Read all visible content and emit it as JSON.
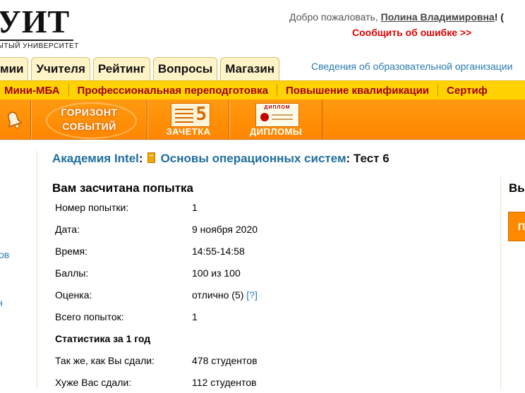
{
  "header": {
    "logo_big": "УИТ",
    "logo_small": "ЫТЫЙ УНИВЕРСИТЕТ",
    "welcome_prefix": "Добро пожаловать, ",
    "user_name": "Полина Владимировна",
    "welcome_suffix": "! (",
    "report_error": "Сообщить об ошибке >>"
  },
  "tabs": [
    "мии",
    "Учителя",
    "Рейтинг",
    "Вопросы",
    "Магазин"
  ],
  "org_info_link": "Сведения об образовательной организации",
  "yellow_menu": [
    "Мини-МБА",
    "Профессиональная переподготовка",
    "Повышение квалификации",
    "Сертиф"
  ],
  "banner": {
    "horizon_line1": "ГОРИЗОНТ",
    "horizon_line2": "СОБЫТИЙ",
    "zachetka": "ЗАЧЕТКА",
    "zachetka_num": "5",
    "diplomas": "ДИПЛОМЫ",
    "diploma_header": "ДИПЛОМ"
  },
  "left_links": [
    "ов",
    "н"
  ],
  "breadcrumb": {
    "academy": "Академия Intel",
    "sep": ":",
    "course": "Основы операционных систем",
    "test": ": Тест 6"
  },
  "main_title": "Вам засчитана попытка",
  "results": {
    "attempt_label": "Номер попытки:",
    "attempt_value": "1",
    "date_label": "Дата:",
    "date_value": "9 ноября 2020",
    "time_label": "Время:",
    "time_value": "14:55-14:58",
    "score_label": "Баллы:",
    "score_value": "100 из 100",
    "grade_label": "Оценка:",
    "grade_value": "отлично (5)",
    "grade_help": "[?]",
    "total_label": "Всего попыток:",
    "total_value": "1",
    "stats_heading": "Статистика за 1 год",
    "same_label": "Так же, как Вы сдали:",
    "same_value": "478 студентов",
    "worse_label": "Хуже Вас сдали:",
    "worse_value": "112 студентов"
  },
  "right_panel": {
    "title": "Вы",
    "button": "П"
  },
  "colors": {
    "orange": "#ff8a00",
    "yellow": "#ffd200",
    "link": "#2a7ab0",
    "menu_text": "#a0000e",
    "error": "#e00000"
  }
}
